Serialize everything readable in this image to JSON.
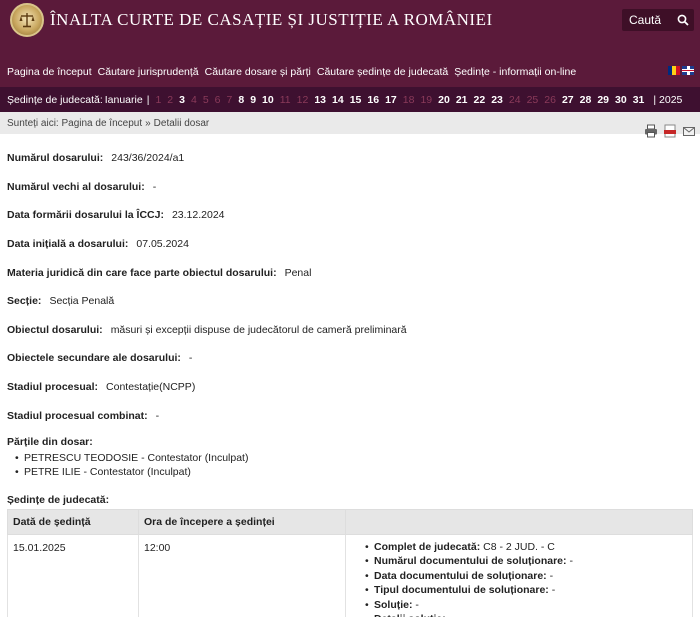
{
  "header": {
    "title": "ÎNALTA CURTE DE CASAȚIE ȘI JUSTIȚIE A ROMÂNIEI",
    "search_label": "Caută"
  },
  "nav": {
    "items": [
      "Pagina de început",
      "Căutare jurisprudență",
      "Căutare dosare și părți",
      "Căutare ședințe de judecată",
      "Ședințe - informații on-line"
    ]
  },
  "sessions_bar": {
    "label": "Ședințe de judecată:",
    "month": "Ianuarie",
    "separator": "|",
    "year_label": "| 2025",
    "days": [
      {
        "d": "1",
        "active": false
      },
      {
        "d": "2",
        "active": false
      },
      {
        "d": "3",
        "active": true
      },
      {
        "d": "4",
        "active": false
      },
      {
        "d": "5",
        "active": false
      },
      {
        "d": "6",
        "active": false
      },
      {
        "d": "7",
        "active": false
      },
      {
        "d": "8",
        "active": true
      },
      {
        "d": "9",
        "active": true
      },
      {
        "d": "10",
        "active": true
      },
      {
        "d": "11",
        "active": false
      },
      {
        "d": "12",
        "active": false
      },
      {
        "d": "13",
        "active": true
      },
      {
        "d": "14",
        "active": true,
        "bold": true
      },
      {
        "d": "15",
        "active": true
      },
      {
        "d": "16",
        "active": true
      },
      {
        "d": "17",
        "active": true
      },
      {
        "d": "18",
        "active": false
      },
      {
        "d": "19",
        "active": false
      },
      {
        "d": "20",
        "active": true
      },
      {
        "d": "21",
        "active": true
      },
      {
        "d": "22",
        "active": true
      },
      {
        "d": "23",
        "active": true
      },
      {
        "d": "24",
        "active": false
      },
      {
        "d": "25",
        "active": false
      },
      {
        "d": "26",
        "active": false
      },
      {
        "d": "27",
        "active": true
      },
      {
        "d": "28",
        "active": true
      },
      {
        "d": "29",
        "active": true
      },
      {
        "d": "30",
        "active": true
      },
      {
        "d": "31",
        "active": true
      }
    ]
  },
  "breadcrumb": {
    "prefix": "Sunteți aici:",
    "home": "Pagina de început",
    "arrow": "»",
    "current": "Detalii dosar"
  },
  "fields": [
    {
      "k": "Numărul dosarului:",
      "v": "243/36/2024/a1"
    },
    {
      "k": "Numărul vechi al dosarului:",
      "v": "-"
    },
    {
      "k": "Data formării dosarului la ÎCCJ:",
      "v": "23.12.2024"
    },
    {
      "k": "Data inițială a dosarului:",
      "v": "07.05.2024"
    },
    {
      "k": "Materia juridică din care face parte obiectul dosarului:",
      "v": "Penal"
    },
    {
      "k": "Secție:",
      "v": "Secția Penală"
    },
    {
      "k": "Obiectul dosarului:",
      "v": "măsuri și excepții dispuse de judecătorul de cameră preliminară"
    },
    {
      "k": "Obiectele secundare ale dosarului:",
      "v": "-"
    },
    {
      "k": "Stadiul procesual:",
      "v": "Contestație(NCPP)"
    },
    {
      "k": "Stadiul procesual combinat:",
      "v": "-"
    }
  ],
  "parties": {
    "title": "Părțile din dosar:",
    "items": [
      "PETRESCU TEODOSIE - Contestator (Inculpat)",
      "PETRE ILIE - Contestator (Inculpat)"
    ]
  },
  "sessions": {
    "title": "Ședințe de judecată:",
    "headers": [
      "Dată de ședință",
      "Ora de începere a ședinței",
      ""
    ],
    "rows": [
      {
        "date": "15.01.2025",
        "time": "12:00",
        "details": [
          {
            "k": "Complet de judecată:",
            "v": "C8 - 2 JUD. - C"
          },
          {
            "k": "Numărul documentului de soluționare:",
            "v": "-"
          },
          {
            "k": "Data documentului de soluționare:",
            "v": "-"
          },
          {
            "k": "Tipul documentului de soluționare:",
            "v": "-"
          },
          {
            "k": "Soluție:",
            "v": "-"
          },
          {
            "k": "Detalii soluție:",
            "v": "-"
          }
        ]
      }
    ]
  },
  "colors": {
    "header_bg": "#5b1a3a",
    "dates_bg": "#3e1030",
    "inactive_day": "#8a3a5a"
  }
}
